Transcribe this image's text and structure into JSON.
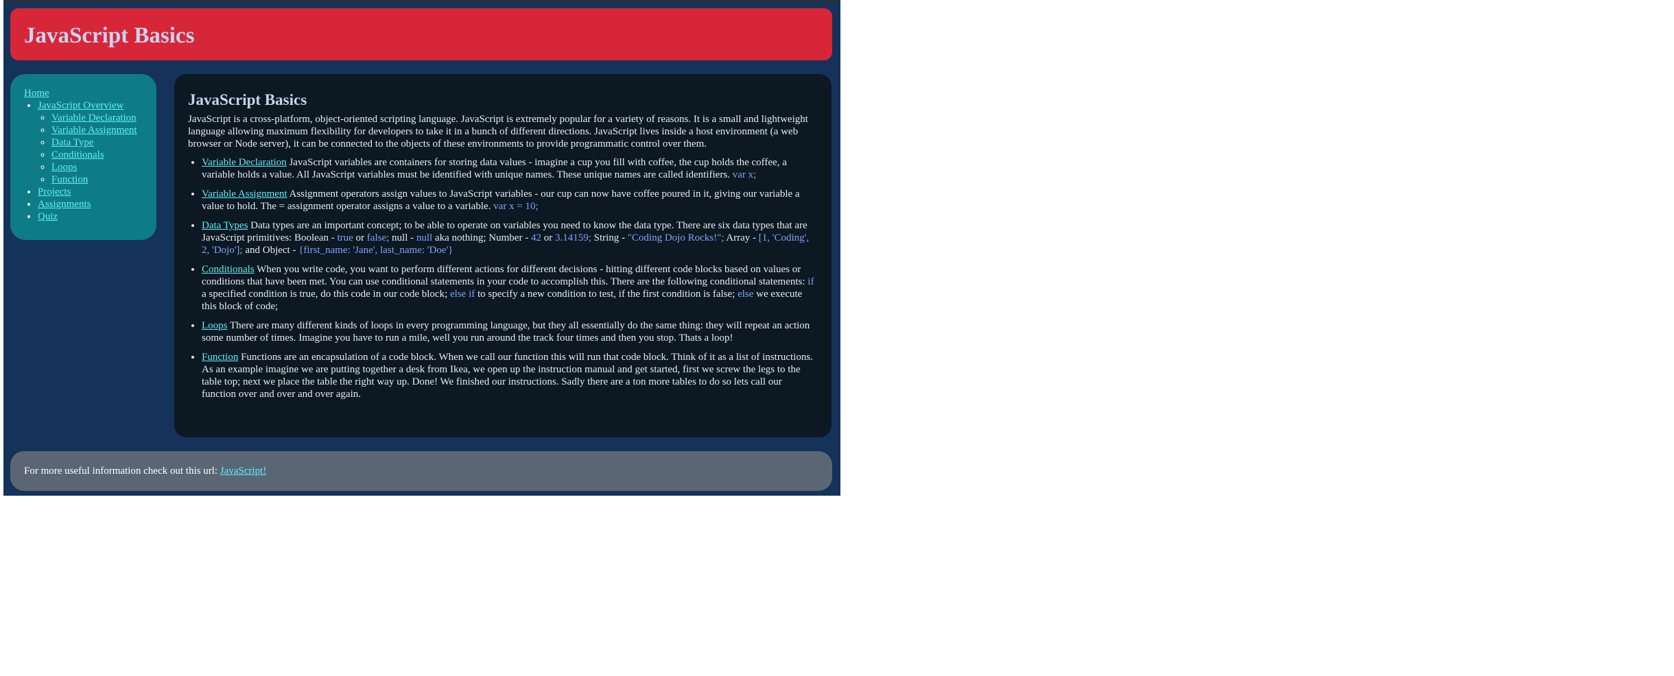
{
  "header": {
    "title": "JavaScript Basics"
  },
  "sidebar": {
    "home": "Home",
    "overview": "JavaScript Overview",
    "sub_items": [
      "Variable Declaration",
      "Variable Assignment",
      "Data Type",
      "Conditionals",
      "Loops",
      "Function"
    ],
    "projects": "Projects",
    "assignments": "Assignments",
    "quiz": "Quiz"
  },
  "content": {
    "title": "JavaScript Basics",
    "intro": "JavaScript is a cross-platform, object-oriented scripting language. JavaScript is extremely popular for a variety of reasons. It is a small and lightweight language allowing maximum flexibility for developers to take it in a bunch of different directions. JavaScript lives inside a host environment (a web browser or Node server), it can be connected to the objects of these environments to provide programmatic control over them.",
    "var_decl": {
      "link": "Variable Declaration",
      "text": " JavaScript variables are containers for storing data values - imagine a cup you fill with coffee, the cup holds the coffee, a variable holds a value. All JavaScript variables must be identified with unique names. These unique names are called identifiers. ",
      "code": "var x;"
    },
    "var_assign": {
      "link": "Variable Assignment",
      "text": " Assignment operators assign values to JavaScript variables - our cup can now have coffee poured in it, giving our variable a value to hold. The = assignment operator assigns a value to a variable. ",
      "code": "var x = 10;"
    },
    "data_types": {
      "link": "Data Types",
      "t1": " Data types are an important concept; to be able to operate on variables you need to know the data type. There are six data types that are JavaScript primitives: Boolean - ",
      "c_true": "true",
      "t2": " or ",
      "c_false": "false;",
      "t3": " null - ",
      "c_null": "null",
      "t4": " aka nothing; Number - ",
      "c_42": "42",
      "t5": " or ",
      "c_pi": "3.14159;",
      "t6": " String - ",
      "c_str": "\"Coding Dojo Rocks!\";",
      "t7": " Array - ",
      "c_arr": "[1, 'Coding', 2, 'Dojo'];",
      "t8": " and Object - ",
      "c_obj": "{first_name: 'Jane', last_name: 'Doe'}"
    },
    "conditionals": {
      "link": "Conditionals",
      "t1": " When you write code, you want to perform different actions for different decisions - hitting different code blocks based on values or conditions that have been met. You can use conditional statements in your code to accomplish this. There are the following conditional statements: ",
      "c_if": "if",
      "t2": " a specified condition is true, do this code in our code block; ",
      "c_elseif": "else if",
      "t3": " to specify a new condition to test, if the first condition is false; ",
      "c_else": "else",
      "t4": " we execute this block of code;"
    },
    "loops": {
      "link": "Loops",
      "text": " There are many different kinds of loops in every programming language, but they all essentially do the same thing: they will repeat an action some number of times. Imagine you have to run a mile, well you run around the track four times and then you stop. Thats a loop!"
    },
    "function": {
      "link": "Function",
      "text": " Functions are an encapsulation of a code block. When we call our function this will run that code block. Think of it as a list of instructions. As an example imagine we are putting together a desk from Ikea, we open up the instruction manual and get started, first we screw the legs to the table top; next we place the table the right way up. Done! We finished our instructions. Sadly there are a ton more tables to do so lets call our function over and over and over again."
    }
  },
  "footer": {
    "text": "For more useful information check out this url: ",
    "link": "JavaScript!"
  }
}
